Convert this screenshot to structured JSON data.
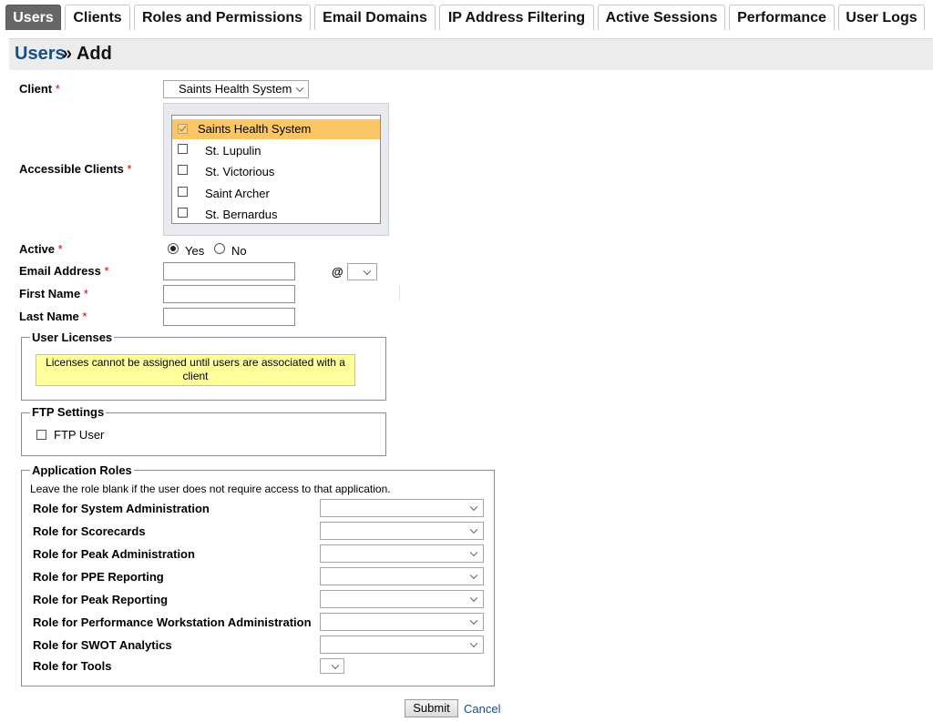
{
  "tabs": [
    {
      "label": "Users",
      "active": true
    },
    {
      "label": "Clients"
    },
    {
      "label": "Roles and Permissions"
    },
    {
      "label": "Email Domains"
    },
    {
      "label": "IP Address Filtering"
    },
    {
      "label": "Active Sessions"
    },
    {
      "label": "Performance"
    },
    {
      "label": "User Logs"
    }
  ],
  "header": {
    "crumb": "Users",
    "separator_title": "» Add"
  },
  "form": {
    "client_label": "Client",
    "client_value": "Saints Health System",
    "accessible_clients_label": "Accessible Clients",
    "accessible_clients": [
      {
        "name": "Saints Health System",
        "checked": true,
        "selected": true
      },
      {
        "name": "St. Lupulin",
        "checked": false
      },
      {
        "name": "St. Victorious",
        "checked": false
      },
      {
        "name": "Saint Archer",
        "checked": false
      },
      {
        "name": "St. Bernardus",
        "checked": false
      }
    ],
    "active_label": "Active",
    "active_yes": "Yes",
    "active_no": "No",
    "active_value": "Yes",
    "email_label": "Email Address",
    "email_at": "@",
    "email_value": "",
    "first_name_label": "First Name",
    "first_name_value": "",
    "last_name_label": "Last Name",
    "last_name_value": "",
    "required_marker": "*"
  },
  "user_licenses": {
    "legend": "User Licenses",
    "note": "Licenses cannot be assigned until users are associated with a client"
  },
  "ftp": {
    "legend": "FTP Settings",
    "ftp_user_label": "FTP User",
    "ftp_user_checked": false
  },
  "app_roles": {
    "legend": "Application Roles",
    "hint": "Leave the role blank if the user does not require access to that application.",
    "roles": [
      {
        "label": "Role for System Administration",
        "value": ""
      },
      {
        "label": "Role for Scorecards",
        "value": ""
      },
      {
        "label": "Role for Peak Administration",
        "value": ""
      },
      {
        "label": "Role for PPE Reporting",
        "value": ""
      },
      {
        "label": "Role for Peak Reporting",
        "value": ""
      },
      {
        "label": "Role for Performance Workstation Administration",
        "value": ""
      },
      {
        "label": "Role for SWOT Analytics",
        "value": ""
      },
      {
        "label": "Role for Tools",
        "value": ""
      }
    ]
  },
  "actions": {
    "submit": "Submit",
    "cancel": "Cancel"
  },
  "colors": {
    "accent": "#174f8a",
    "active_tab": "#666666",
    "selected_row": "#fbc664",
    "note_bg": "#ffff9c",
    "required": "#cc0000"
  }
}
